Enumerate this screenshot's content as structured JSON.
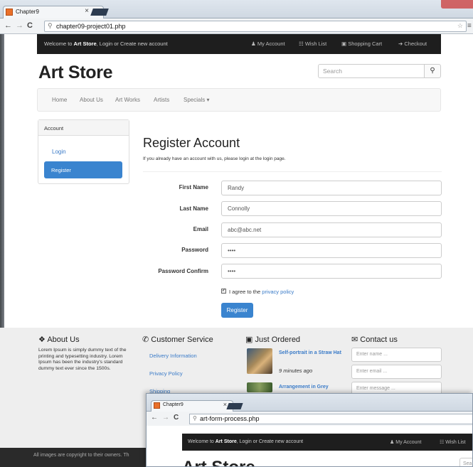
{
  "browser": {
    "tab_title": "Chapter9",
    "tab_close": "×",
    "url": "chapter09-project01.php",
    "back": "←",
    "forward": "→",
    "reload": "C",
    "url_icon": "magnifier-icon",
    "menu_glyph": "≡",
    "star_glyph": "☆"
  },
  "topbar": {
    "welcome_prefix": "Welcome to ",
    "welcome_brand": "Art Store",
    "welcome_suffix": ", Login or Create new account",
    "links": [
      {
        "icon": "user-icon",
        "glyph": "♟",
        "label": "My Account"
      },
      {
        "icon": "list-icon",
        "glyph": "☷",
        "label": "Wish List"
      },
      {
        "icon": "cart-icon",
        "glyph": "🛒",
        "label": "Shopping Cart"
      },
      {
        "icon": "arrow-right-icon",
        "glyph": "➔",
        "label": "Checkout"
      }
    ]
  },
  "header": {
    "logo": "Art Store",
    "search_placeholder": "Search",
    "search_glyph": "🔍"
  },
  "mainnav": {
    "items": [
      "Home",
      "About Us",
      "Art Works",
      "Artists",
      "Specials ▾"
    ]
  },
  "sidebar": {
    "heading": "Account",
    "items": [
      "Login",
      "Register"
    ],
    "active": "Register"
  },
  "form": {
    "title": "Register Account",
    "subtitle": "If you already have an account with us, please login at the login page.",
    "fields": [
      {
        "label": "First Name",
        "value": "Randy"
      },
      {
        "label": "Last Name",
        "value": "Connolly"
      },
      {
        "label": "Email",
        "value": "abc@abc.net"
      },
      {
        "label": "Password",
        "value": "••••"
      },
      {
        "label": "Password Confirm",
        "value": "••••"
      }
    ],
    "agree_checked": true,
    "agree_text": "I agree to the ",
    "agree_link": "privacy policy",
    "submit_label": "Register"
  },
  "footer": {
    "about": {
      "heading": "About Us",
      "text": "Lorem Ipsum is simply dummy text of the printing and typesetting industry. Lorem Ipsum has been the industry's standard dummy text ever since the 1500s."
    },
    "service": {
      "heading": "Customer Service",
      "links": [
        "Delivery Information",
        "Privacy Policy",
        "Shipping"
      ]
    },
    "ordered": {
      "heading": "Just Ordered",
      "items": [
        {
          "title": "Self-portrait in a Straw Hat",
          "time": "9 minutes ago"
        },
        {
          "title": "Arrangement in Grey",
          "time": ""
        }
      ]
    },
    "contact": {
      "heading": "Contact us",
      "name_placeholder": "Enter name ...",
      "email_placeholder": "Enter email ...",
      "message_placeholder": "Enter message ..."
    },
    "copyright": "All images are copyright to their owners. Th"
  },
  "second_window": {
    "tab_title": "Chapter9",
    "tab_close": "×",
    "url": "art-form-process.php",
    "back": "←",
    "forward": "→",
    "reload": "C",
    "welcome_prefix": "Welcome to ",
    "welcome_brand": "Art Store",
    "welcome_suffix": ", Login or Create new account",
    "link_account": "My Account",
    "link_wish": "Wish List",
    "logo": "Art Store",
    "search_partial": "Sea"
  },
  "colors": {
    "accent": "#3a84cf",
    "link": "#3a7bc8",
    "topbar": "#1e1e1e",
    "footer": "#eeeeee"
  }
}
